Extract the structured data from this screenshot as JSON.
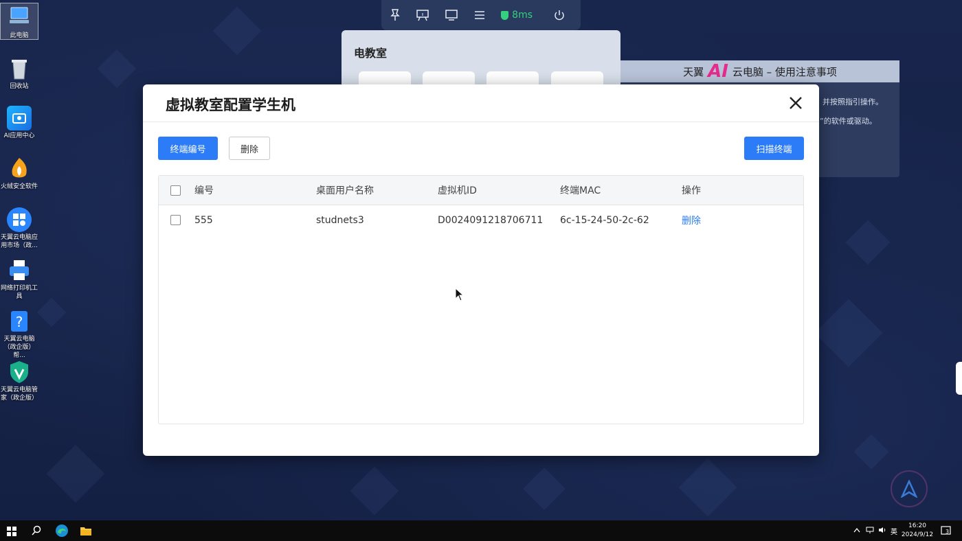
{
  "desktop": {
    "icons": [
      {
        "label": "此电脑"
      },
      {
        "label": "回收站"
      },
      {
        "label": "AI应用中心"
      },
      {
        "label": "火绒安全软件"
      },
      {
        "label": "天翼云电脑应用市场（政..."
      },
      {
        "label": "网络打印机工具"
      },
      {
        "label": "天翼云电脑（政企版）帮..."
      },
      {
        "label": "天翼云电脑管家（政企版）"
      }
    ]
  },
  "toolbar": {
    "latency": "8ms",
    "icons": [
      "pin-icon",
      "presentation-icon",
      "monitor-icon",
      "menu-icon",
      "power-icon"
    ]
  },
  "classroom_panel": {
    "title": "电教室"
  },
  "notice_panel": {
    "title_left": "天翼",
    "title_ai": "AI",
    "title_right": "云电脑 – 使用注意事项",
    "line1": "并按照指引操作。",
    "line2": "”的软件或驱动。"
  },
  "modal": {
    "title": "虚拟教室配置学生机",
    "buttons": {
      "terminal_number": "终端编号",
      "delete": "删除",
      "scan_terminal": "扫描终端"
    },
    "table": {
      "headers": [
        "编号",
        "桌面用户名称",
        "虚拟机ID",
        "终端MAC",
        "操作"
      ],
      "rows": [
        {
          "id": "555",
          "username": "studnets3",
          "vm_id": "D0024091218706711",
          "mac": "6c-15-24-50-2c-62",
          "action": "删除"
        }
      ]
    }
  },
  "taskbar": {
    "ime": "英",
    "time": "16:20",
    "date": "2024/9/12",
    "notification_count": "3"
  },
  "colors": {
    "primary": "#2b7cf6",
    "latency_green": "#35d07f",
    "desktop_bg": "#16234a"
  }
}
